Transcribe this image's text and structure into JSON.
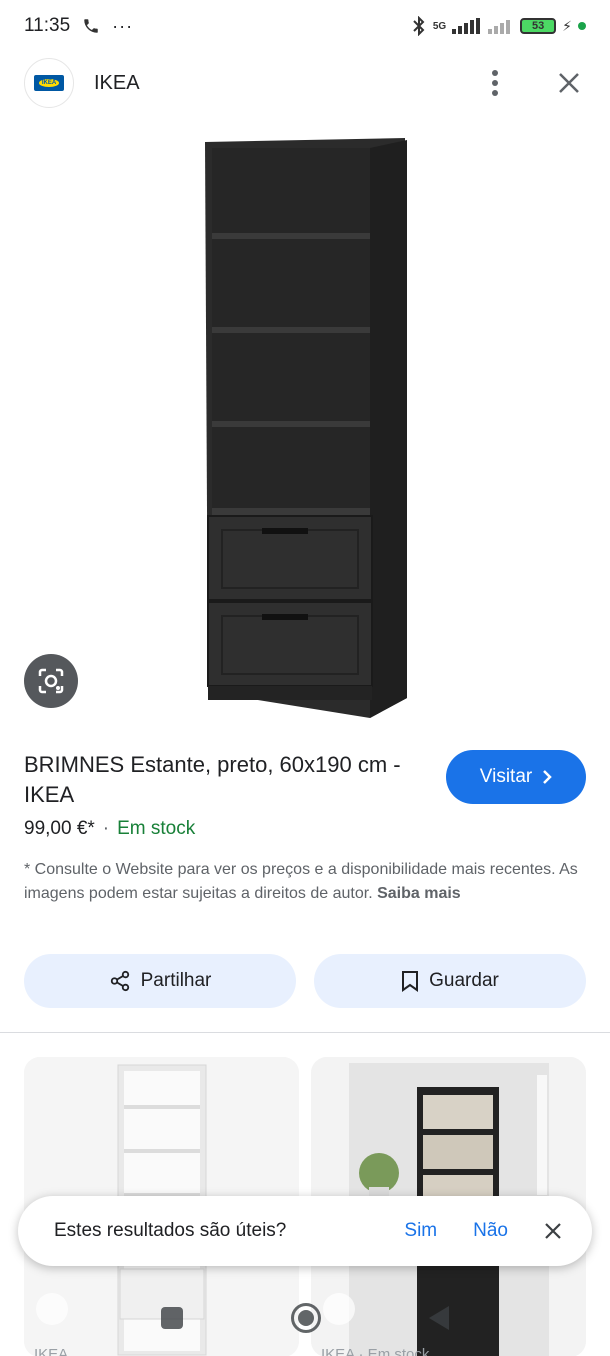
{
  "status": {
    "time": "11:35",
    "network": "5G",
    "battery": "53"
  },
  "header": {
    "site_name": "IKEA",
    "logo_text": "IKEA"
  },
  "product": {
    "title": "BRIMNES Estante, preto, 60x190 cm - IKEA",
    "price": "99,00 €*",
    "separator": "·",
    "availability": "Em stock",
    "disclaimer": "* Consulte o Website para ver os preços e a disponibilidade mais recentes. As imagens podem estar sujeitas a direitos de autor.",
    "learn_more": "Saiba mais"
  },
  "buttons": {
    "visit": "Visitar",
    "share": "Partilhar",
    "save": "Guardar"
  },
  "related": [
    {
      "source": "IKEA"
    },
    {
      "source": "IKEA · Em stock"
    }
  ],
  "feedback": {
    "question": "Estes resultados são úteis?",
    "yes": "Sim",
    "no": "Não"
  },
  "colors": {
    "accent": "#1a73e8",
    "stock": "#188038",
    "pill_bg": "#e8f0fe"
  },
  "icons": [
    "phone-icon",
    "more-icon",
    "bluetooth-icon",
    "signal-icon",
    "battery-icon",
    "more-vert-icon",
    "close-icon",
    "lens-icon",
    "chevron-right-icon",
    "share-icon",
    "bookmark-icon",
    "tag-icon",
    "nav-recents-icon",
    "nav-home-icon",
    "nav-back-icon"
  ]
}
